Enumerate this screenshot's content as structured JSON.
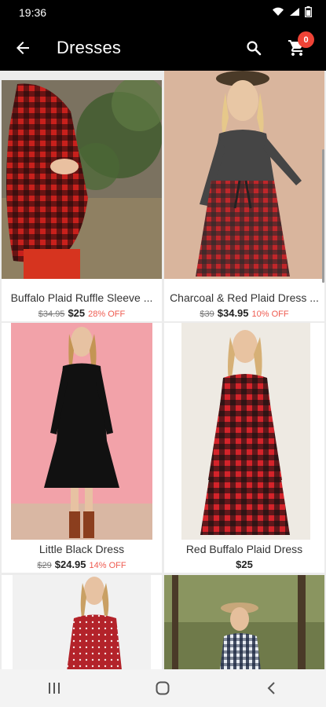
{
  "status_bar": {
    "time": "19:36",
    "icons": [
      "wifi-icon",
      "signal-icon",
      "battery-icon"
    ]
  },
  "app_bar": {
    "title": "Dresses",
    "cart_count": "0",
    "back_icon": "arrow-left-icon",
    "search_icon": "search-icon",
    "cart_icon": "cart-icon"
  },
  "products": [
    {
      "name": "Buffalo Plaid Ruffle Sleeve Dress",
      "name_display": "Buffalo Plaid Ruffle Sleeve ...",
      "old_price": "$34.95",
      "price": "$25",
      "discount": "28% OFF"
    },
    {
      "name": "Charcoal & Red Plaid Dress",
      "name_display": "Charcoal & Red Plaid Dress ...",
      "old_price": "$39",
      "price": "$34.95",
      "discount": "10% OFF"
    },
    {
      "name": "Little Black Dress",
      "name_display": "Little Black Dress",
      "old_price": "$29",
      "price": "$24.95",
      "discount": "14% OFF"
    },
    {
      "name": "Red Buffalo Plaid Dress",
      "name_display": "Red Buffalo Plaid Dress",
      "old_price": "",
      "price": "$25",
      "discount": ""
    },
    {
      "name": "",
      "name_display": "",
      "old_price": "",
      "price": "",
      "discount": ""
    },
    {
      "name": "",
      "name_display": "",
      "old_price": "",
      "price": "",
      "discount": ""
    }
  ],
  "nav_bar": {
    "icons": [
      "recent-apps-icon",
      "home-icon",
      "back-icon"
    ]
  },
  "colors": {
    "app_bar": "#000000",
    "badge": "#ef4336",
    "discount": "#ef5b50",
    "background": "#ececec"
  }
}
